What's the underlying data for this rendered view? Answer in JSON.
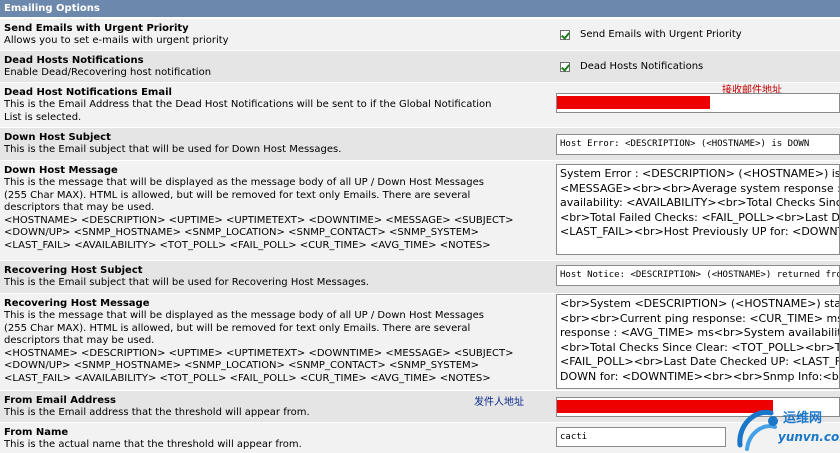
{
  "section_title": "Emailing Options",
  "rows": {
    "urgent": {
      "title": "Send Emails with Urgent Priority",
      "desc": "Allows you to set e-mails with urgent priority",
      "checkbox_label": "Send Emails with Urgent Priority",
      "checked": true
    },
    "dead_hosts": {
      "title": "Dead Hosts Notifications",
      "desc": "Enable Dead/Recovering host notification",
      "checkbox_label": "Dead Hosts Notifications",
      "checked": true
    },
    "dead_email": {
      "title": "Dead Host Notifications Email",
      "desc": "This is the Email Address that the Dead Host Notifications will be sent to if the Global Notification\nList is selected.",
      "annotation": "接收邮件地址"
    },
    "down_subject": {
      "title": "Down Host Subject",
      "desc": "This is the Email subject that will be used for Down Host Messages.",
      "value": "Host Error: <DESCRIPTION> (<HOSTNAME>) is DOWN"
    },
    "down_message": {
      "title": "Down Host Message",
      "desc": "This is the message that will be displayed as the message body of all UP / Down Host Messages\n(255 Char MAX). HTML is allowed, but will be removed for text only Emails. There are several\ndescriptors that may be used.\n<HOSTNAME> <DESCRIPTION> <UPTIME> <UPTIMETEXT> <DOWNTIME> <MESSAGE> <SUBJECT>\n<DOWN/UP> <SNMP_HOSTNAME> <SNMP_LOCATION> <SNMP_CONTACT> <SNMP_SYSTEM>\n<LAST_FAIL> <AVAILABILITY> <TOT_POLL> <FAIL_POLL> <CUR_TIME> <AVG_TIME> <NOTES>",
      "value_lines": [
        "System Error : <DESCRIPTION> (<HOSTNAME>) is <DOWN/UP>",
        "<MESSAGE><br><br>Average system response : <AVG_TIME> ms",
        "availability: <AVAILABILITY><br>Total Checks Since Clear",
        "<br>Total Failed Checks: <FAIL_POLL><br>Last Date Checked",
        "<LAST_FAIL><br>Host Previously UP for: <DOWNTIME>"
      ]
    },
    "recovering_subject": {
      "title": "Recovering Host Subject",
      "desc": "This is the Email subject that will be used for Recovering Host Messages.",
      "value": "Host Notice: <DESCRIPTION> (<HOSTNAME>) returned from DOWN"
    },
    "recovering_message": {
      "title": "Recovering Host Message",
      "desc": "This is the message that will be displayed as the message body of all UP / Down Host Messages\n(255 Char MAX). HTML is allowed, but will be removed for text only Emails. There are several\ndescriptors that may be used.\n<HOSTNAME> <DESCRIPTION> <UPTIME> <UPTIMETEXT> <DOWNTIME> <MESSAGE> <SUBJECT>\n<DOWN/UP> <SNMP_HOSTNAME> <SNMP_LOCATION> <SNMP_CONTACT> <SNMP_SYSTEM>\n<LAST_FAIL> <AVAILABILITY> <TOT_POLL> <FAIL_POLL> <CUR_TIME> <AVG_TIME> <NOTES>",
      "value_lines": [
        "<br>System <DESCRIPTION> (<HOSTNAME>) status: <DOWN/UP>",
        "<br><br>Current ping response: <CUR_TIME> ms<br>Average",
        "response : <AVG_TIME> ms<br>System availability: <AVAILABILITY>",
        "<br>Total Checks Since Clear: <TOT_POLL><br>Total Failed Checks:",
        "<FAIL_POLL><br>Last Date Checked UP: <LAST_FAIL><br>Host",
        "DOWN for: <DOWNTIME><br><br>Snmp Info:<br>"
      ]
    },
    "from_email": {
      "title": "From Email Address",
      "desc": "This is the Email address that the threshold will appear from.",
      "annotation": "发件人地址"
    },
    "from_name": {
      "title": "From Name",
      "desc": "This is the actual name that the threshold will appear from.",
      "value": "cacti"
    }
  },
  "watermark": {
    "cn": "运维网",
    "url": "yunvn.com"
  },
  "colors": {
    "header_bg": "#6d88ad",
    "row_light": "#f2f2f2",
    "row_dark": "#e5e5e5",
    "redaction": "#ee0000",
    "annotation": "#c00000",
    "watermark": "#1a76c9"
  }
}
